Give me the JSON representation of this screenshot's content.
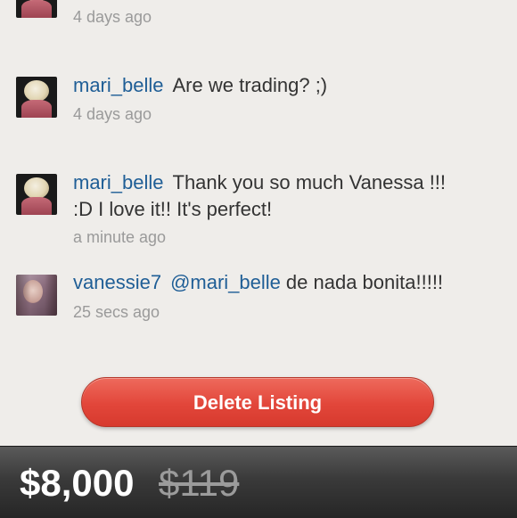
{
  "comments": [
    {
      "user": "",
      "message": "",
      "time": "4 days ago",
      "avatar": "avatar-bw"
    },
    {
      "user": "mari_belle",
      "message": "Are we trading? ;)",
      "time": "4 days ago",
      "avatar": "avatar-bw"
    },
    {
      "user": "mari_belle",
      "message": "Thank you so much Vanessa !!! :D I love it!! It's perfect!",
      "time": "a minute ago",
      "avatar": "avatar-bw"
    },
    {
      "user": "vanessie7",
      "mention": "@mari_belle",
      "message": "de nada bonita!!!!!",
      "time": "25 secs ago",
      "avatar": "avatar-photo"
    }
  ],
  "actions": {
    "delete_label": "Delete Listing"
  },
  "price": {
    "current": "$8,000",
    "original": "$119"
  },
  "colors": {
    "username": "#1f5e96",
    "delete_button": "#e2463a",
    "price_bar": "#333333",
    "timestamp": "#9a9a9a"
  }
}
